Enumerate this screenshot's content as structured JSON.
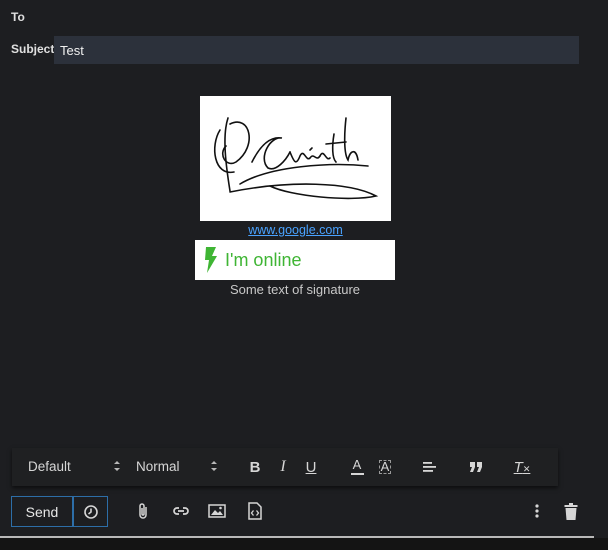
{
  "header": {
    "to_label": "To",
    "subject_label": "Subject",
    "subject_value": "Test"
  },
  "signature": {
    "image_alt": "handwritten signature",
    "link_text": "www.google.com",
    "status_text": "I'm online",
    "status_color": "#3fb534",
    "body_text": "Some text of signature"
  },
  "format_toolbar": {
    "font_select": "Default",
    "size_select": "Normal",
    "icons": [
      "bold-icon",
      "italic-icon",
      "underline-icon",
      "text-color-icon",
      "highlight-color-icon",
      "align-left-icon",
      "blockquote-icon",
      "clear-format-icon"
    ],
    "bold_label": "B",
    "italic_label": "I",
    "underline_label": "U",
    "text_color_label": "A",
    "highlight_label": "A",
    "clear_label": "T"
  },
  "actions": {
    "send_label": "Send",
    "icons": [
      "schedule-icon",
      "attach-icon",
      "link-icon",
      "image-icon",
      "file-code-icon",
      "more-vert-icon",
      "trash-icon"
    ],
    "accent_color": "#2d6ea8"
  }
}
